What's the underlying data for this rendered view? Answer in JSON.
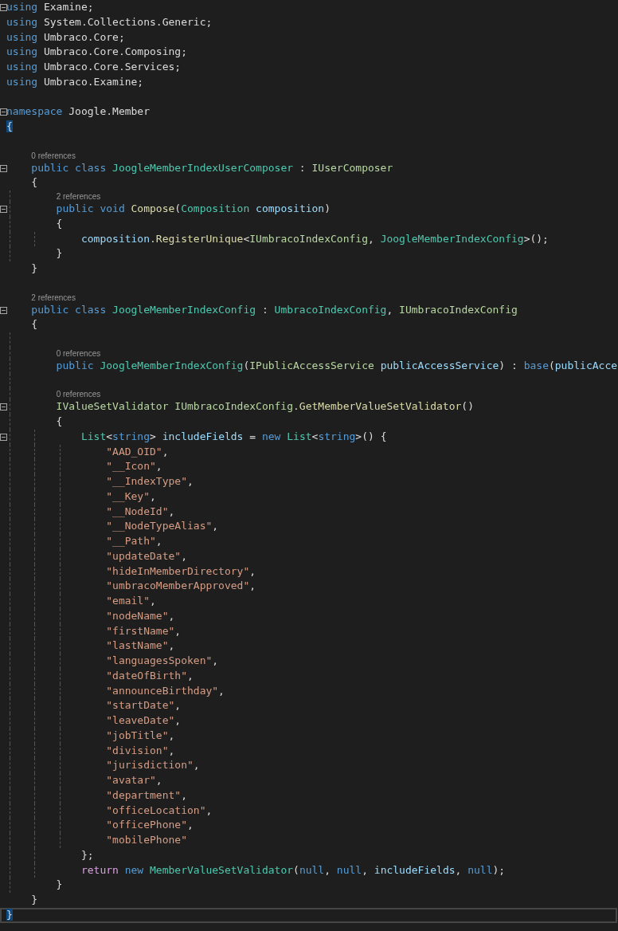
{
  "editor": {
    "lines": [
      {
        "kind": "code",
        "expanded": true,
        "tokens": [
          {
            "kind": "keyword",
            "s": "using "
          },
          {
            "kind": "plain",
            "s": "Examine;"
          }
        ]
      },
      {
        "kind": "code",
        "tokens": [
          {
            "kind": "keyword",
            "s": "using "
          },
          {
            "kind": "plain",
            "s": "System.Collections.Generic;"
          }
        ]
      },
      {
        "kind": "code",
        "tokens": [
          {
            "kind": "keyword",
            "s": "using "
          },
          {
            "kind": "plain",
            "s": "Umbraco.Core;"
          }
        ]
      },
      {
        "kind": "code",
        "tokens": [
          {
            "kind": "keyword",
            "s": "using "
          },
          {
            "kind": "plain",
            "s": "Umbraco.Core.Composing;"
          }
        ]
      },
      {
        "kind": "code",
        "tokens": [
          {
            "kind": "keyword",
            "s": "using "
          },
          {
            "kind": "plain",
            "s": "Umbraco.Core.Services;"
          }
        ]
      },
      {
        "kind": "code",
        "tokens": [
          {
            "kind": "keyword",
            "s": "using "
          },
          {
            "kind": "plain",
            "s": "Umbraco.Examine;"
          }
        ]
      },
      {
        "kind": "blank"
      },
      {
        "kind": "code",
        "expanded": true,
        "tokens": [
          {
            "kind": "keyword",
            "s": "namespace "
          },
          {
            "kind": "plain",
            "s": "Joogle.Member"
          }
        ]
      },
      {
        "kind": "code",
        "tokens": [
          {
            "kind": "plain",
            "s": "{",
            "match": true
          }
        ]
      },
      {
        "kind": "blank"
      },
      {
        "kind": "lens",
        "text": "0 references"
      },
      {
        "kind": "code",
        "expanded": true,
        "tokens": [
          {
            "kind": "keyword",
            "s": "    public class "
          },
          {
            "kind": "type",
            "s": "JoogleMemberIndexUserComposer"
          },
          {
            "kind": "plain",
            "s": " : "
          },
          {
            "kind": "interface",
            "s": "IUserComposer"
          }
        ]
      },
      {
        "kind": "code",
        "tokens": [
          {
            "kind": "plain",
            "s": "    {"
          }
        ]
      },
      {
        "kind": "lens",
        "text": "2 references"
      },
      {
        "kind": "code",
        "expanded": true,
        "tokens": [
          {
            "kind": "keyword",
            "s": "        public void "
          },
          {
            "kind": "method",
            "s": "Compose"
          },
          {
            "kind": "plain",
            "s": "("
          },
          {
            "kind": "type",
            "s": "Composition "
          },
          {
            "kind": "param",
            "s": "composition"
          },
          {
            "kind": "plain",
            "s": ")"
          }
        ]
      },
      {
        "kind": "code",
        "tokens": [
          {
            "kind": "plain",
            "s": "        {"
          }
        ]
      },
      {
        "kind": "code",
        "tokens": [
          {
            "kind": "param",
            "s": "            composition"
          },
          {
            "kind": "method",
            "s": ".RegisterUnique"
          },
          {
            "kind": "plain",
            "s": "<"
          },
          {
            "kind": "interface",
            "s": "IUmbracoIndexConfig"
          },
          {
            "kind": "plain",
            "s": ", "
          },
          {
            "kind": "type",
            "s": "JoogleMemberIndexConfig"
          },
          {
            "kind": "plain",
            "s": ">();"
          }
        ]
      },
      {
        "kind": "code",
        "tokens": [
          {
            "kind": "plain",
            "s": "        }"
          }
        ]
      },
      {
        "kind": "code",
        "tokens": [
          {
            "kind": "plain",
            "s": "    }"
          }
        ]
      },
      {
        "kind": "blank"
      },
      {
        "kind": "lens",
        "text": "2 references"
      },
      {
        "kind": "code",
        "expanded": true,
        "tokens": [
          {
            "kind": "keyword",
            "s": "    public class "
          },
          {
            "kind": "type",
            "s": "JoogleMemberIndexConfig"
          },
          {
            "kind": "plain",
            "s": " : "
          },
          {
            "kind": "type",
            "s": "UmbracoIndexConfig"
          },
          {
            "kind": "plain",
            "s": ", "
          },
          {
            "kind": "interface",
            "s": "IUmbracoIndexConfig"
          }
        ]
      },
      {
        "kind": "code",
        "tokens": [
          {
            "kind": "plain",
            "s": "    {"
          }
        ]
      },
      {
        "kind": "blank"
      },
      {
        "kind": "lens",
        "text": "0 references"
      },
      {
        "kind": "code",
        "tokens": [
          {
            "kind": "keyword",
            "s": "        public "
          },
          {
            "kind": "type",
            "s": "JoogleMemberIndexConfig"
          },
          {
            "kind": "plain",
            "s": "("
          },
          {
            "kind": "interface",
            "s": "IPublicAccessService "
          },
          {
            "kind": "param",
            "s": "publicAccessService"
          },
          {
            "kind": "plain",
            "s": ") : "
          },
          {
            "kind": "keyword",
            "s": "base"
          },
          {
            "kind": "plain",
            "s": "("
          },
          {
            "kind": "param",
            "s": "publicAcce"
          }
        ]
      },
      {
        "kind": "blank"
      },
      {
        "kind": "lens",
        "text": "0 references"
      },
      {
        "kind": "code",
        "expanded": true,
        "tokens": [
          {
            "kind": "interface",
            "s": "        IValueSetValidator IUmbracoIndexConfig"
          },
          {
            "kind": "method",
            "s": ".GetMemberValueSetValidator"
          },
          {
            "kind": "plain",
            "s": "()"
          }
        ]
      },
      {
        "kind": "code",
        "tokens": [
          {
            "kind": "plain",
            "s": "        {"
          }
        ]
      },
      {
        "kind": "code",
        "expanded": true,
        "tokens": [
          {
            "kind": "type",
            "s": "            List"
          },
          {
            "kind": "plain",
            "s": "<"
          },
          {
            "kind": "keyword",
            "s": "string"
          },
          {
            "kind": "plain",
            "s": "> "
          },
          {
            "kind": "param",
            "s": "includeFields"
          },
          {
            "kind": "plain",
            "s": " = "
          },
          {
            "kind": "keyword",
            "s": "new "
          },
          {
            "kind": "type",
            "s": "List"
          },
          {
            "kind": "plain",
            "s": "<"
          },
          {
            "kind": "keyword",
            "s": "string"
          },
          {
            "kind": "plain",
            "s": ">() {"
          }
        ]
      },
      {
        "kind": "code",
        "tokens": [
          {
            "kind": "string",
            "s": "                \"AAD_OID\""
          },
          {
            "kind": "plain",
            "s": ","
          }
        ]
      },
      {
        "kind": "code",
        "tokens": [
          {
            "kind": "string",
            "s": "                \"__Icon\""
          },
          {
            "kind": "plain",
            "s": ","
          }
        ]
      },
      {
        "kind": "code",
        "tokens": [
          {
            "kind": "string",
            "s": "                \"__IndexType\""
          },
          {
            "kind": "plain",
            "s": ","
          }
        ]
      },
      {
        "kind": "code",
        "tokens": [
          {
            "kind": "string",
            "s": "                \"__Key\""
          },
          {
            "kind": "plain",
            "s": ","
          }
        ]
      },
      {
        "kind": "code",
        "tokens": [
          {
            "kind": "string",
            "s": "                \"__NodeId\""
          },
          {
            "kind": "plain",
            "s": ","
          }
        ]
      },
      {
        "kind": "code",
        "tokens": [
          {
            "kind": "string",
            "s": "                \"__NodeTypeAlias\""
          },
          {
            "kind": "plain",
            "s": ","
          }
        ]
      },
      {
        "kind": "code",
        "tokens": [
          {
            "kind": "string",
            "s": "                \"__Path\""
          },
          {
            "kind": "plain",
            "s": ","
          }
        ]
      },
      {
        "kind": "code",
        "tokens": [
          {
            "kind": "string",
            "s": "                \"updateDate\""
          },
          {
            "kind": "plain",
            "s": ","
          }
        ]
      },
      {
        "kind": "code",
        "tokens": [
          {
            "kind": "string",
            "s": "                \"hideInMemberDirectory\""
          },
          {
            "kind": "plain",
            "s": ","
          }
        ]
      },
      {
        "kind": "code",
        "tokens": [
          {
            "kind": "string",
            "s": "                \"umbracoMemberApproved\""
          },
          {
            "kind": "plain",
            "s": ","
          }
        ]
      },
      {
        "kind": "code",
        "tokens": [
          {
            "kind": "string",
            "s": "                \"email\""
          },
          {
            "kind": "plain",
            "s": ","
          }
        ]
      },
      {
        "kind": "code",
        "tokens": [
          {
            "kind": "string",
            "s": "                \"nodeName\""
          },
          {
            "kind": "plain",
            "s": ","
          }
        ]
      },
      {
        "kind": "code",
        "tokens": [
          {
            "kind": "string",
            "s": "                \"firstName\""
          },
          {
            "kind": "plain",
            "s": ","
          }
        ]
      },
      {
        "kind": "code",
        "tokens": [
          {
            "kind": "string",
            "s": "                \"lastName\""
          },
          {
            "kind": "plain",
            "s": ","
          }
        ]
      },
      {
        "kind": "code",
        "tokens": [
          {
            "kind": "string",
            "s": "                \"languagesSpoken\""
          },
          {
            "kind": "plain",
            "s": ","
          }
        ]
      },
      {
        "kind": "code",
        "tokens": [
          {
            "kind": "string",
            "s": "                \"dateOfBirth\""
          },
          {
            "kind": "plain",
            "s": ","
          }
        ]
      },
      {
        "kind": "code",
        "tokens": [
          {
            "kind": "string",
            "s": "                \"announceBirthday\""
          },
          {
            "kind": "plain",
            "s": ","
          }
        ]
      },
      {
        "kind": "code",
        "tokens": [
          {
            "kind": "string",
            "s": "                \"startDate\""
          },
          {
            "kind": "plain",
            "s": ","
          }
        ]
      },
      {
        "kind": "code",
        "tokens": [
          {
            "kind": "string",
            "s": "                \"leaveDate\""
          },
          {
            "kind": "plain",
            "s": ","
          }
        ]
      },
      {
        "kind": "code",
        "tokens": [
          {
            "kind": "string",
            "s": "                \"jobTitle\""
          },
          {
            "kind": "plain",
            "s": ","
          }
        ]
      },
      {
        "kind": "code",
        "tokens": [
          {
            "kind": "string",
            "s": "                \"division\""
          },
          {
            "kind": "plain",
            "s": ","
          }
        ]
      },
      {
        "kind": "code",
        "tokens": [
          {
            "kind": "string",
            "s": "                \"jurisdiction\""
          },
          {
            "kind": "plain",
            "s": ","
          }
        ]
      },
      {
        "kind": "code",
        "tokens": [
          {
            "kind": "string",
            "s": "                \"avatar\""
          },
          {
            "kind": "plain",
            "s": ","
          }
        ]
      },
      {
        "kind": "code",
        "tokens": [
          {
            "kind": "string",
            "s": "                \"department\""
          },
          {
            "kind": "plain",
            "s": ","
          }
        ]
      },
      {
        "kind": "code",
        "tokens": [
          {
            "kind": "string",
            "s": "                \"officeLocation\""
          },
          {
            "kind": "plain",
            "s": ","
          }
        ]
      },
      {
        "kind": "code",
        "tokens": [
          {
            "kind": "string",
            "s": "                \"officePhone\""
          },
          {
            "kind": "plain",
            "s": ","
          }
        ]
      },
      {
        "kind": "code",
        "tokens": [
          {
            "kind": "string",
            "s": "                \"mobilePhone\""
          }
        ]
      },
      {
        "kind": "code",
        "tokens": [
          {
            "kind": "plain",
            "s": "            };"
          }
        ]
      },
      {
        "kind": "code",
        "tokens": [
          {
            "kind": "control",
            "s": "            return "
          },
          {
            "kind": "keyword",
            "s": "new "
          },
          {
            "kind": "type",
            "s": "MemberValueSetValidator"
          },
          {
            "kind": "plain",
            "s": "("
          },
          {
            "kind": "keyword",
            "s": "null"
          },
          {
            "kind": "plain",
            "s": ", "
          },
          {
            "kind": "keyword",
            "s": "null"
          },
          {
            "kind": "plain",
            "s": ", "
          },
          {
            "kind": "param",
            "s": "includeFields"
          },
          {
            "kind": "plain",
            "s": ", "
          },
          {
            "kind": "keyword",
            "s": "null"
          },
          {
            "kind": "plain",
            "s": ");"
          }
        ]
      },
      {
        "kind": "code",
        "tokens": [
          {
            "kind": "plain",
            "s": "        }"
          }
        ]
      },
      {
        "kind": "code",
        "tokens": [
          {
            "kind": "plain",
            "s": "    }"
          }
        ]
      },
      {
        "kind": "code",
        "current": true,
        "tokens": [
          {
            "kind": "plain",
            "s": "}",
            "match": true
          }
        ]
      }
    ]
  }
}
